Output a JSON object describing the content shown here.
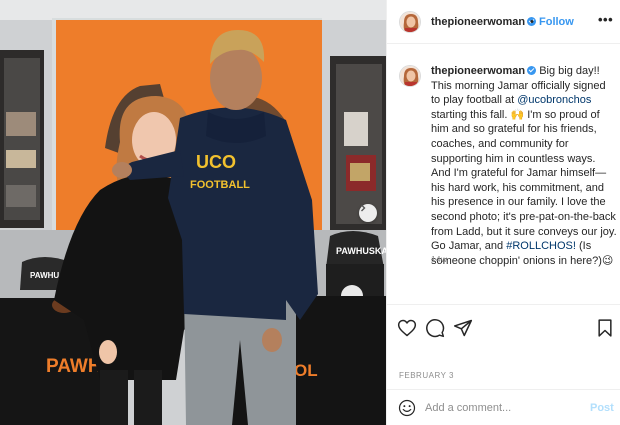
{
  "header": {
    "username": "thepioneerwoman",
    "separator": "•",
    "follow_label": "Follow",
    "more_label": "•••"
  },
  "caption": {
    "username": "thepioneerwoman",
    "part1": "Big big day!! This morning Jamar officially signed to play football at ",
    "mention": "@ucobronchos",
    "part2": " starting this fall. 🙌 I'm so proud of him and so grateful for his friends, coaches, and community for supporting him in countless ways. And I'm grateful for Jamar himself—his hard work, his commitment, and his presence in our family. I love the second photo; it's pre-pat-on-the-back from Ladd, but it sure conveys our joy. Go Jamar, and ",
    "hashtag": "#ROLLCHOS!",
    "part3": " (Is someone choppin' onions in here?)😉",
    "age": "14w"
  },
  "photo": {
    "hoodie_logo": "UCO",
    "hoodie_text": "FOOTBALL",
    "chair_text": "PAWHUSKA",
    "table_text_left": "PAWH",
    "table_text_right": "OL",
    "left_chair_text": "PAWHU"
  },
  "footer": {
    "date": "FEBRUARY 3",
    "comment_placeholder": "Add a comment...",
    "post_label": "Post"
  },
  "colors": {
    "accent": "#3897f0",
    "post_disabled": "#b2dffc",
    "link": "#00376b",
    "muted": "#8e8e8e"
  }
}
